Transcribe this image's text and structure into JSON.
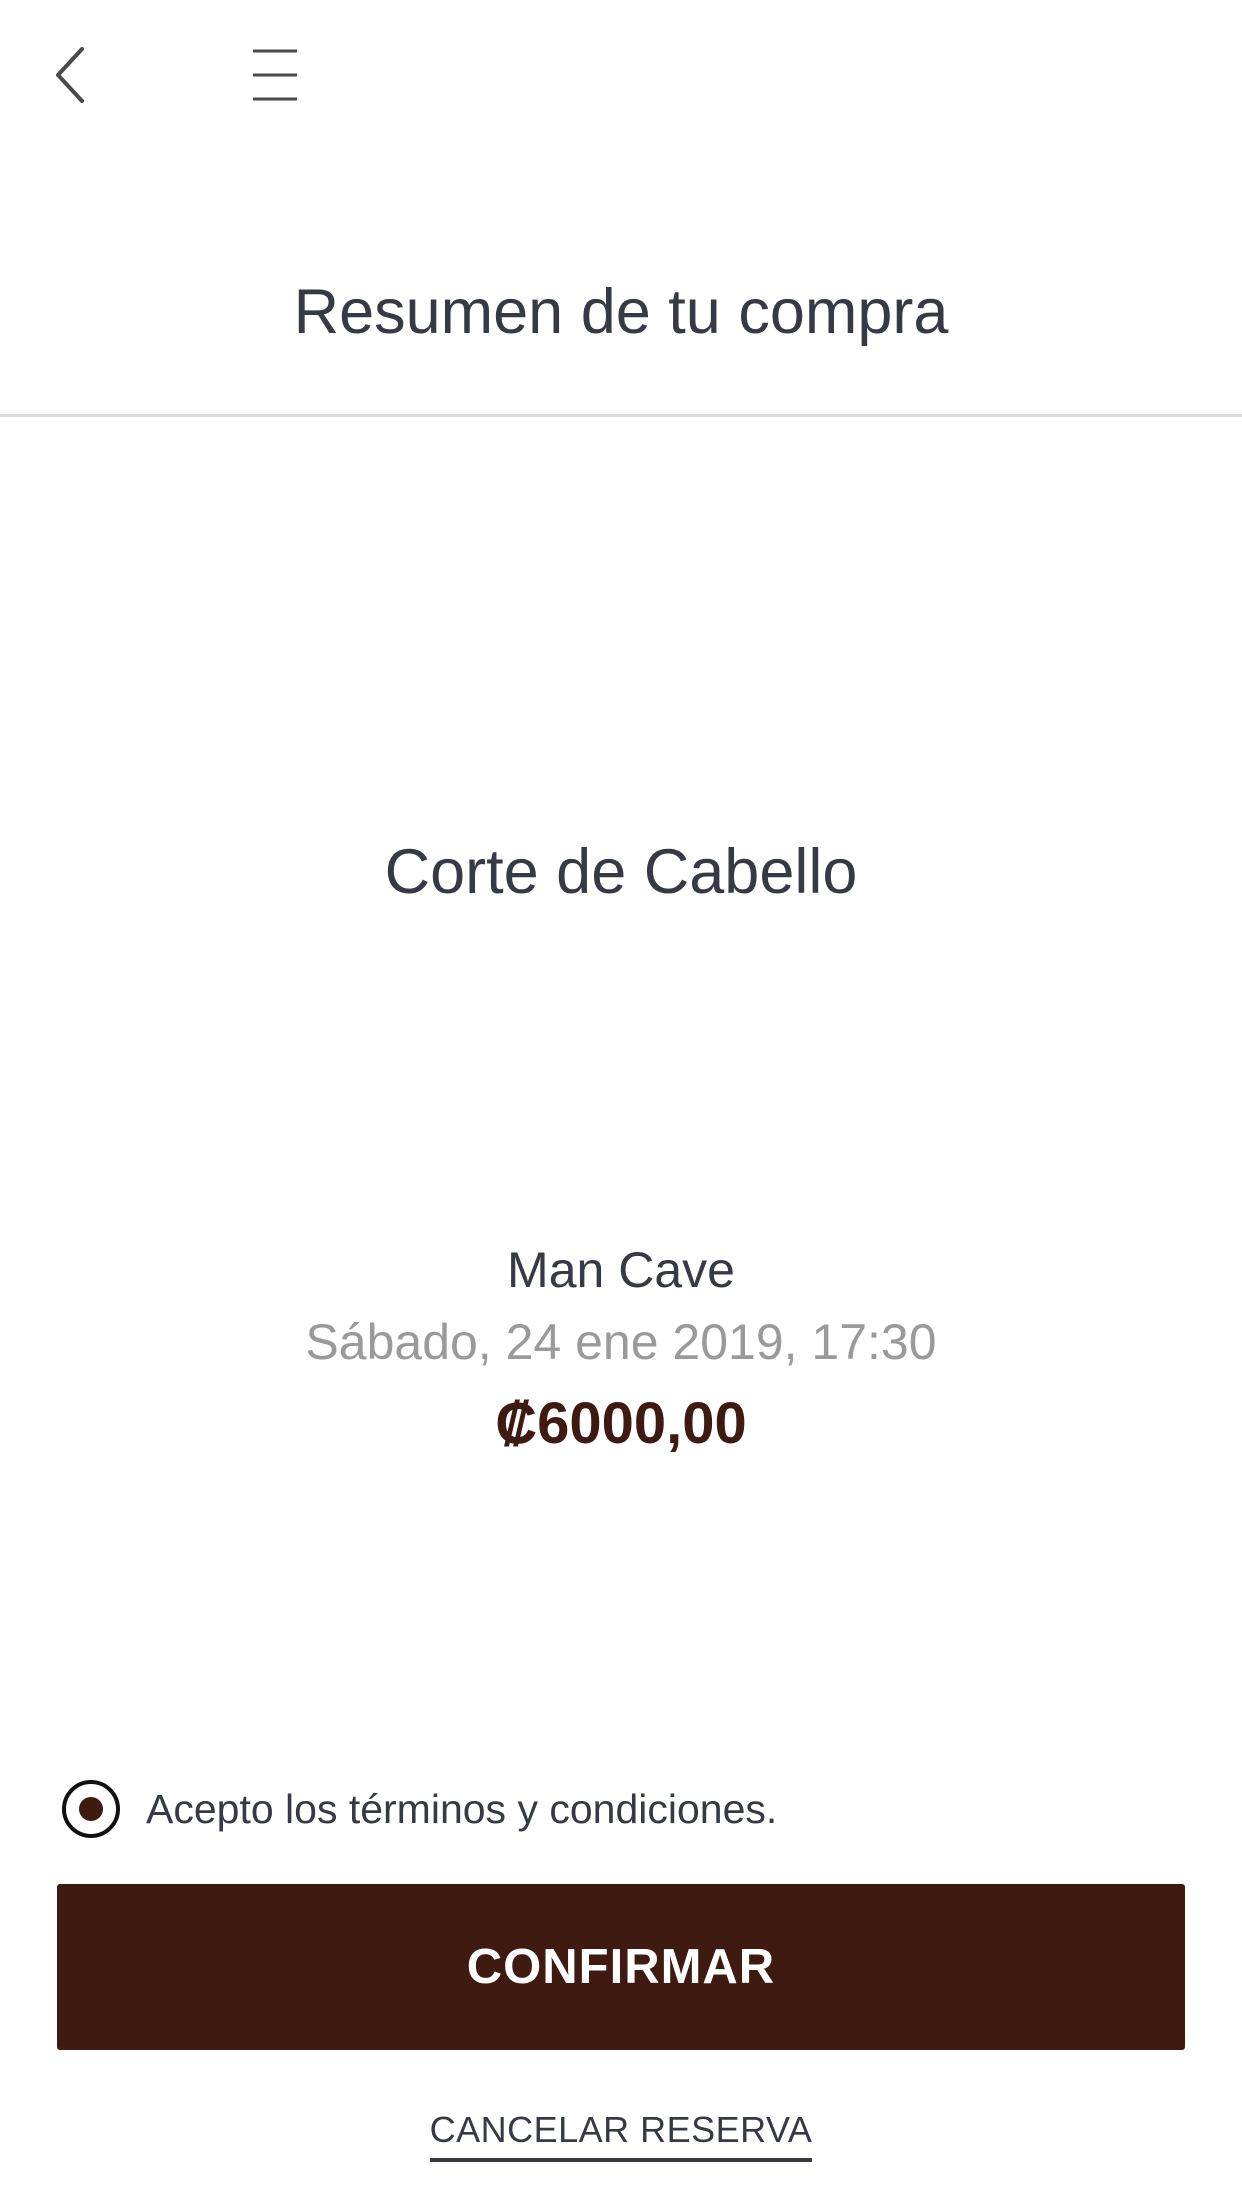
{
  "header": {
    "back_icon": "chevron-left-icon",
    "menu_icon": "hamburger-menu-icon",
    "title": "Resumen de tu compra"
  },
  "summary": {
    "service": "Corte de Cabello",
    "venue": "Man Cave",
    "datetime": "Sábado, 24 ene 2019, 17:30",
    "price": "₡6000,00"
  },
  "terms": {
    "label": "Acepto los términos y condiciones.",
    "checked": true
  },
  "actions": {
    "confirm_label": "CONFIRMAR",
    "cancel_label": "CANCELAR RESERVA"
  },
  "colors": {
    "brand": "#3e1a10",
    "text": "#363a45",
    "muted": "#9a9a9a",
    "divider": "#dddddd"
  }
}
